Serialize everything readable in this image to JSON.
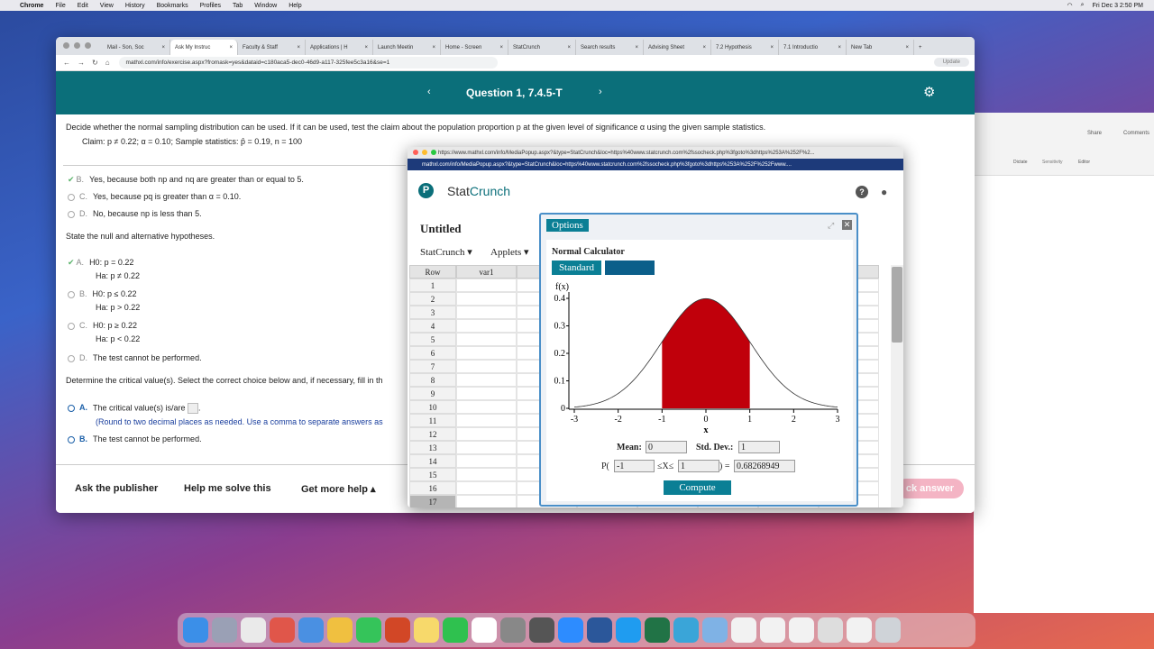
{
  "menubar": {
    "app": "Chrome",
    "items": [
      "File",
      "Edit",
      "View",
      "History",
      "Bookmarks",
      "Profiles",
      "Tab",
      "Window",
      "Help"
    ],
    "clock": "Fri Dec 3  2:50 PM"
  },
  "browser": {
    "tabs": [
      "Mail - Son, Soc",
      "Ask My Instruc",
      "Faculty & Staff",
      "Applications | H",
      "Launch Meetin",
      "Home - Screen",
      "StatCrunch",
      "Search results",
      "Advising Sheet",
      "7.2 Hypothesis",
      "7.1 Introductio",
      "New Tab"
    ],
    "url": "mathxl.com/info/exercise.aspx?fromask=yes&dataid=c180aca5-dec0-46d9-a117-325fee5c3a16&se=1",
    "update_label": "Update"
  },
  "question": {
    "title": "Question 1, 7.4.5-T",
    "prompt": "Decide whether the normal sampling distribution can be used. If it can be used, test the claim about the population proportion p at the given level of significance α using the given sample statistics.",
    "claim": "Claim: p ≠ 0.22; α = 0.10; Sample statistics: p̂ = 0.19, n = 100",
    "choices1": [
      {
        "letter": "B.",
        "text": "Yes, because both np and nq are greater than or equal to 5."
      },
      {
        "letter": "C.",
        "text": "Yes, because pq is greater than α = 0.10."
      },
      {
        "letter": "D.",
        "text": "No, because np is less than 5."
      }
    ],
    "hyp_prompt": "State the null and alternative hypotheses.",
    "hyp_choices": [
      {
        "letter": "A.",
        "h0": "H0: p = 0.22",
        "ha": "Ha: p ≠ 0.22"
      },
      {
        "letter": "B.",
        "h0": "H0: p ≤ 0.22",
        "ha": "Ha: p > 0.22"
      },
      {
        "letter": "C.",
        "h0": "H0: p ≥ 0.22",
        "ha": "Ha: p < 0.22"
      }
    ],
    "hyp_d": {
      "letter": "D.",
      "text": "The test cannot be performed."
    },
    "crit_prompt": "Determine the critical value(s). Select the correct choice below and, if necessary, fill in th",
    "crit_a": {
      "letter": "A.",
      "text": "The critical value(s) is/are",
      "note": "(Round to two decimal places as needed. Use a comma to separate answers as"
    },
    "crit_b": {
      "letter": "B.",
      "text": "The test cannot be performed."
    },
    "bottom": {
      "ask": "Ask the publisher",
      "help": "Help me solve this",
      "more": "Get more help ▴",
      "check": "ck answer"
    }
  },
  "popup": {
    "title_url": "https://www.mathxl.com/info/MediaPopup.aspx?&type=StatCrunch&loc=https%40www.statcrunch.com%2fssocheck.php%3fgoto%3dhttps%253A%252F%2...",
    "url": "mathxl.com/info/MediaPopup.aspx?&type=StatCrunch&loc=https%40www.statcrunch.com%2fssocheck.php%3fgoto%3dhttps%253A%252F%252Fwww....",
    "brand_a": "Stat",
    "brand_b": "Crunch",
    "doc_title": "Untitled",
    "menu1": "StatCrunch ▾",
    "menu2": "Applets ▾",
    "col_row": "Row",
    "col_var1": "var1",
    "rows": [
      "1",
      "2",
      "3",
      "4",
      "5",
      "6",
      "7",
      "8",
      "9",
      "10",
      "11",
      "12",
      "13",
      "14",
      "15",
      "16",
      "17"
    ]
  },
  "options": {
    "title": "Options",
    "calc_title": "Normal Calculator",
    "tab1": "Standard",
    "tab2": "",
    "mean_label": "Mean:",
    "mean": "0",
    "sd_label": "Std. Dev.:",
    "sd": "1",
    "p_open": "P(",
    "lower": "-1",
    "between": "≤X≤",
    "upper": "1",
    "equals": ") =",
    "result": "0.68268949",
    "compute": "Compute"
  },
  "chart_data": {
    "type": "area",
    "title": "",
    "ylabel": "f(x)",
    "xlabel": "x",
    "xlim": [
      -3,
      3
    ],
    "ylim": [
      0,
      0.4
    ],
    "xticks": [
      "-3",
      "-2",
      "-1",
      "0",
      "1",
      "2",
      "3"
    ],
    "yticks": [
      "0",
      "0.1",
      "0.2",
      "0.3",
      "0.4"
    ],
    "mean": 0,
    "sd": 1,
    "shaded_interval": [
      -1,
      1
    ],
    "fill_color": "#c0000b"
  },
  "word": {
    "share": "Share",
    "comments": "Comments",
    "dictate": "Dictate",
    "sensitivity": "Sensitivity",
    "editor": "Editor",
    "styles": "Styles Pane"
  }
}
